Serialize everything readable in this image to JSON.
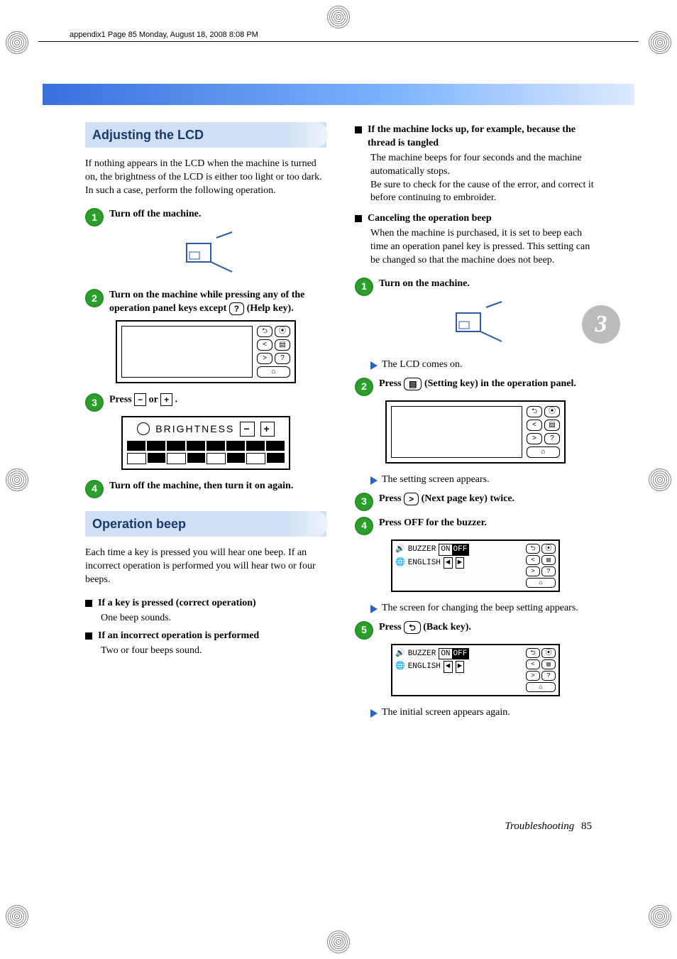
{
  "header": "appendix1  Page 85  Monday, August 18, 2008  8:08 PM",
  "side_tab": "3",
  "left": {
    "section1_title": "Adjusting the LCD",
    "section1_intro": "If nothing appears in the LCD when the machine is turned on, the brightness of the LCD is either too light or too dark. In such a case, perform the following operation.",
    "step1": "Turn off the machine.",
    "step2a": "Turn on the machine while pressing any of the operation panel keys except ",
    "step2b": " (Help key).",
    "step3a": "Press ",
    "step3b": " or ",
    "step3c": " .",
    "brightness_label": "BRIGHTNESS",
    "step4": "Turn off the machine, then turn it on again.",
    "section2_title": "Operation beep",
    "section2_intro": "Each time a key is pressed you will hear one beep. If an incorrect operation is performed you will hear two or four beeps.",
    "b1_head": "If a key is pressed (correct operation)",
    "b1_body": "One beep sounds.",
    "b2_head": "If an incorrect operation is performed",
    "b2_body": "Two or four beeps sound."
  },
  "right": {
    "b3_head": "If the machine locks up, for example, because the thread is tangled",
    "b3_body1": "The machine beeps for four seconds and the machine automatically stops.",
    "b3_body2": "Be sure to check for the cause of the error, and correct it before continuing to embroider.",
    "b4_head": "Canceling the operation beep",
    "b4_body": "When the machine is purchased, it is set to beep each time an operation panel key is pressed. This setting can be changed so that the machine does not beep.",
    "r_step1": "Turn on the machine.",
    "r_step1_res": "The LCD comes on.",
    "r_step2a": "Press ",
    "r_step2b": " (Setting key) in the operation panel.",
    "r_step2_res": "The setting screen appears.",
    "r_step3a": "Press ",
    "r_step3b": " (Next page key) twice.",
    "r_step4": "Press OFF for the buzzer.",
    "buzzer_label": "BUZZER",
    "english_label": "ENGLISH",
    "on_label": "ON",
    "off_label": "OFF",
    "r_step4_res": "The screen for changing the beep setting appears.",
    "r_step5a": "Press ",
    "r_step5b": " (Back key).",
    "r_step5_res": "The initial screen appears again."
  },
  "footer_label": "Troubleshooting",
  "footer_page": "85"
}
